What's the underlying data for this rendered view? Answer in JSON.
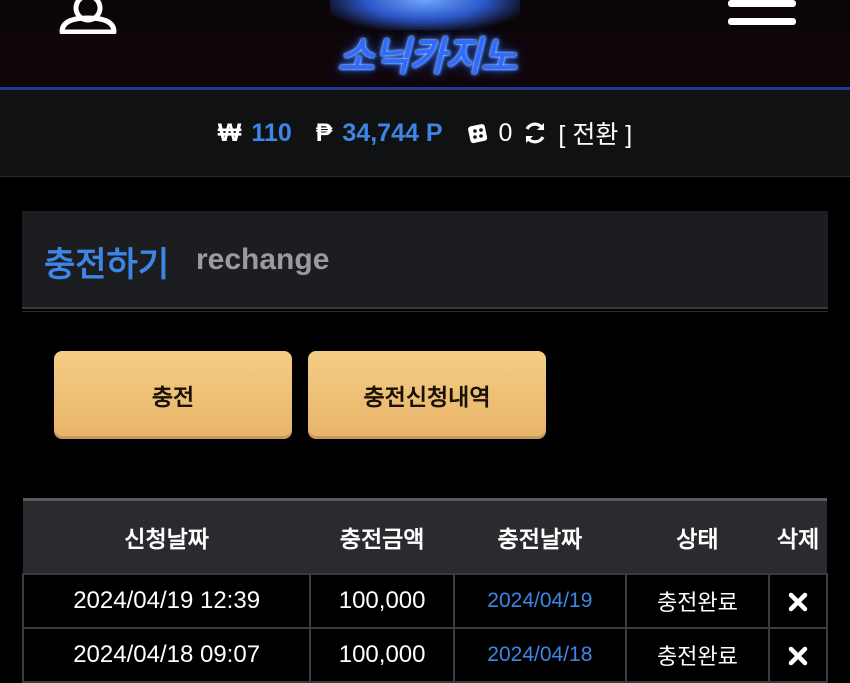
{
  "header": {
    "logo_text": "소닉카지노",
    "user_icon": "user-icon",
    "menu_icon": "hamburger-menu-icon"
  },
  "balance": {
    "won_symbol": "₩",
    "won_value": "110",
    "point_symbol": "₱",
    "point_value": "34,744 P",
    "dice_icon": "dice-icon",
    "dice_value": "0",
    "refresh_icon": "refresh-icon",
    "convert_label": "[ 전환 ]"
  },
  "title": {
    "korean": "충전하기",
    "english": "rechange"
  },
  "buttons": {
    "charge": "충전",
    "history": "충전신청내역"
  },
  "table": {
    "headers": [
      "신청날짜",
      "충전금액",
      "충전날짜",
      "상태",
      "삭제"
    ],
    "rows": [
      {
        "request_date": "2024/04/19 12:39",
        "amount": "100,000",
        "charge_date": "2024/04/19",
        "status": "충전완료"
      },
      {
        "request_date": "2024/04/18 09:07",
        "amount": "100,000",
        "charge_date": "2024/04/18",
        "status": "충전완료"
      }
    ]
  },
  "colors": {
    "accent_blue": "#3d86e6",
    "button_gold": "#f0c27a",
    "panel": "#1c1d21"
  }
}
